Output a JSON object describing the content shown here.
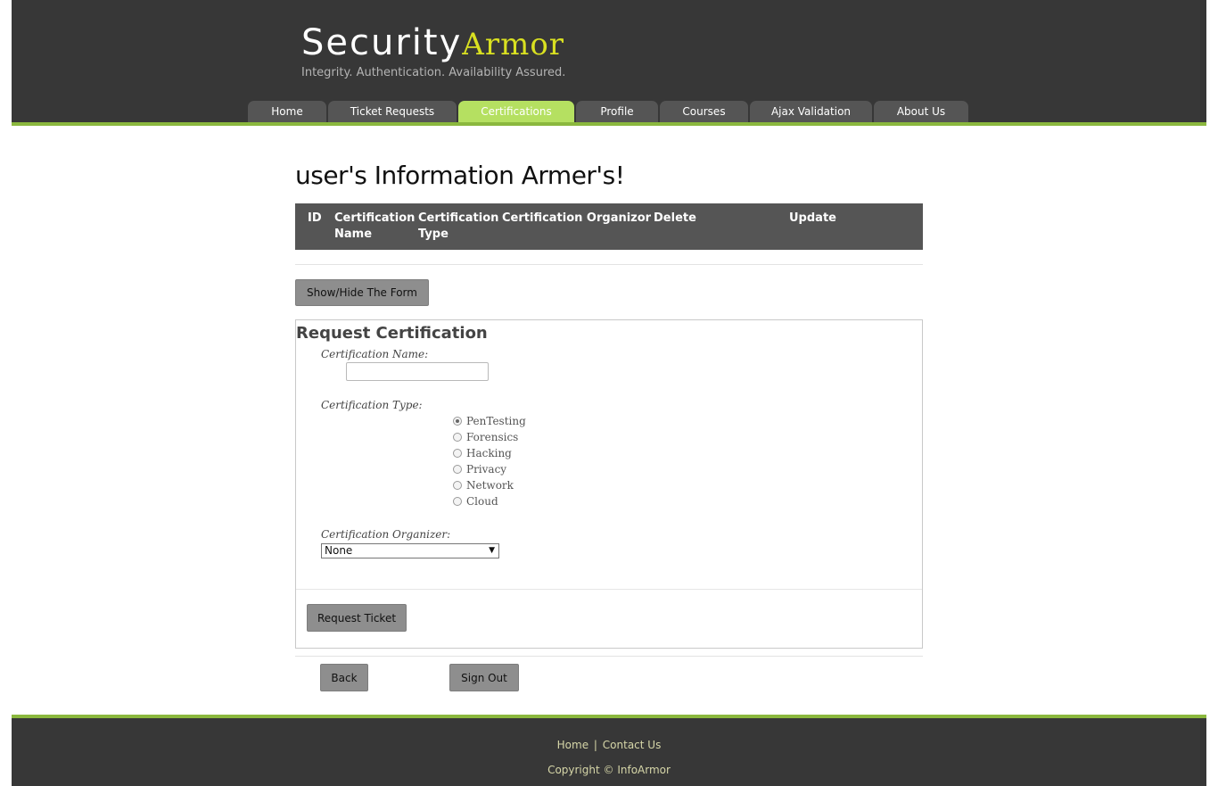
{
  "brand": {
    "name_part1": "Security",
    "name_part2": "Armor",
    "tagline": "Integrity. Authentication. Availability Assured."
  },
  "nav": {
    "tabs": [
      {
        "label": "Home"
      },
      {
        "label": "Ticket Requests"
      },
      {
        "label": "Certifications",
        "active": true
      },
      {
        "label": "Profile"
      },
      {
        "label": "Courses"
      },
      {
        "label": "Ajax Validation"
      },
      {
        "label": "About Us"
      }
    ]
  },
  "page": {
    "title": "user's Information Armer's!"
  },
  "table": {
    "headers": {
      "id": "ID",
      "cert_name": "Certification Name",
      "cert_type": "Certification Type",
      "cert_organizer": "Certification Organizor",
      "delete": "Delete",
      "update": "Update"
    },
    "rows": []
  },
  "toggle_form_button": "Show/Hide The Form",
  "form": {
    "title": "Request Certification",
    "name_label": "Certification Name:",
    "name_value": "",
    "type_label": "Certification Type:",
    "type_options": [
      {
        "label": "PenTesting",
        "checked": true
      },
      {
        "label": "Forensics",
        "checked": false
      },
      {
        "label": "Hacking",
        "checked": false
      },
      {
        "label": "Privacy",
        "checked": false
      },
      {
        "label": "Network",
        "checked": false
      },
      {
        "label": "Cloud",
        "checked": false
      }
    ],
    "organizer_label": "Certification Organizer:",
    "organizer_selected": "None",
    "submit_label": "Request Ticket"
  },
  "actions": {
    "back_label": "Back",
    "signout_label": "Sign Out"
  },
  "footer": {
    "link_home": "Home",
    "separator": "|",
    "link_contact": "Contact Us",
    "copyright": "Copyright © InfoArmor"
  },
  "colors": {
    "header_bg": "#373737",
    "accent_green": "#8bb83e",
    "active_tab": "#b5e061",
    "brand_accent": "#d9e021",
    "button_gray": "#8e8e8e"
  }
}
